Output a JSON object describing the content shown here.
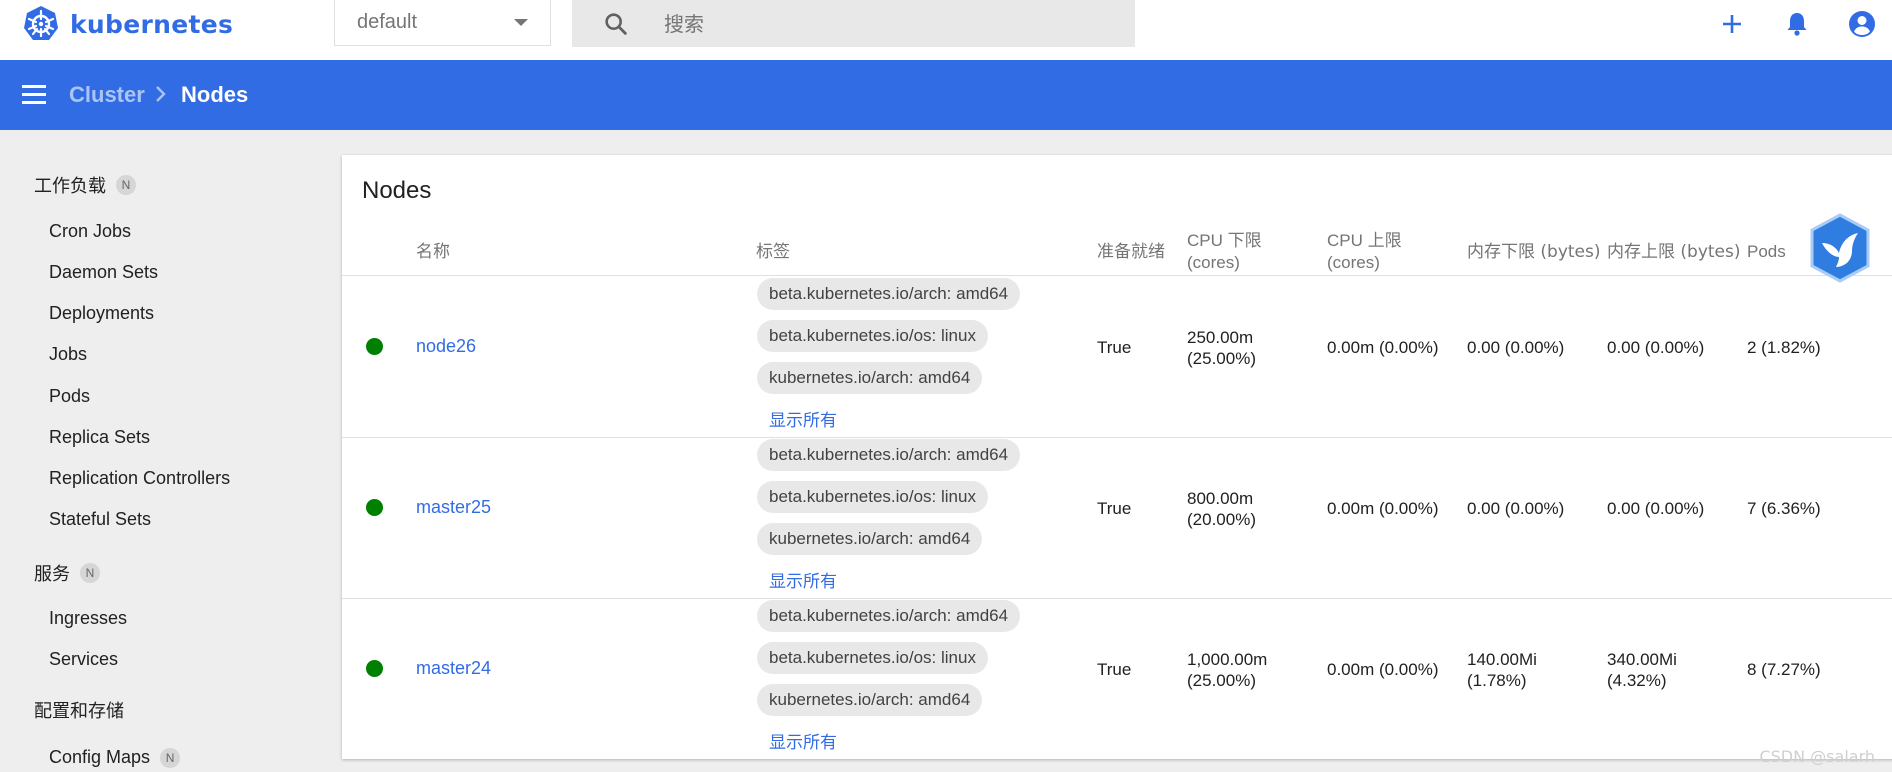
{
  "app": {
    "logo_text": "kubernetes",
    "logo_icon": "helm-wheel-icon",
    "brand_color": "#326ce5"
  },
  "toolbar": {
    "namespace_selected": "default",
    "search_placeholder": "搜索",
    "actions": [
      {
        "name": "create-button",
        "icon": "plus-icon"
      },
      {
        "name": "notifications-button",
        "icon": "bell-icon"
      },
      {
        "name": "account-button",
        "icon": "account-circle-icon"
      }
    ]
  },
  "breadcrumb": {
    "parent": "Cluster",
    "current": "Nodes"
  },
  "sidebar": {
    "sections": [
      {
        "label": "工作负载",
        "badge": "N",
        "items": [
          "Cron Jobs",
          "Daemon Sets",
          "Deployments",
          "Jobs",
          "Pods",
          "Replica Sets",
          "Replication Controllers",
          "Stateful Sets"
        ]
      },
      {
        "label": "服务",
        "badge": "N",
        "items": [
          "Ingresses",
          "Services"
        ]
      },
      {
        "label": "配置和存储",
        "items": [
          {
            "label": "Config Maps",
            "badge": "N"
          }
        ]
      }
    ]
  },
  "card": {
    "title": "Nodes",
    "columns": [
      "名称",
      "标签",
      "准备就绪",
      "CPU 下限 (cores)",
      "CPU 上限 (cores)",
      "内存下限 (bytes)",
      "内存上限 (bytes)",
      "Pods"
    ],
    "rows": [
      {
        "status": "ready",
        "name": "node26",
        "labels": [
          "beta.kubernetes.io/arch: amd64",
          "beta.kubernetes.io/os: linux",
          "kubernetes.io/arch: amd64"
        ],
        "show_all": "显示所有",
        "ready": "True",
        "cpu_requests": [
          "250.00m",
          "(25.00%)"
        ],
        "cpu_limits": "0.00m (0.00%)",
        "mem_requests": [
          "0.00 (0.00%)"
        ],
        "mem_limits": [
          "0.00 (0.00%)"
        ],
        "pods": "2 (1.82%)"
      },
      {
        "status": "ready",
        "name": "master25",
        "labels": [
          "beta.kubernetes.io/arch: amd64",
          "beta.kubernetes.io/os: linux",
          "kubernetes.io/arch: amd64"
        ],
        "show_all": "显示所有",
        "ready": "True",
        "cpu_requests": [
          "800.00m",
          "(20.00%)"
        ],
        "cpu_limits": "0.00m (0.00%)",
        "mem_requests": [
          "0.00 (0.00%)"
        ],
        "mem_limits": [
          "0.00 (0.00%)"
        ],
        "pods": "7 (6.36%)"
      },
      {
        "status": "ready",
        "name": "master24",
        "labels": [
          "beta.kubernetes.io/arch: amd64",
          "beta.kubernetes.io/os: linux",
          "kubernetes.io/arch: amd64"
        ],
        "show_all": "显示所有",
        "ready": "True",
        "cpu_requests": [
          "1,000.00m",
          "(25.00%)"
        ],
        "cpu_limits": "0.00m (0.00%)",
        "mem_requests": [
          "140.00Mi",
          "(1.78%)"
        ],
        "mem_limits": [
          "340.00Mi",
          "(4.32%)"
        ],
        "pods": "8 (7.27%)"
      }
    ],
    "status_color": "#008000"
  },
  "watermark": "CSDN @salarh"
}
